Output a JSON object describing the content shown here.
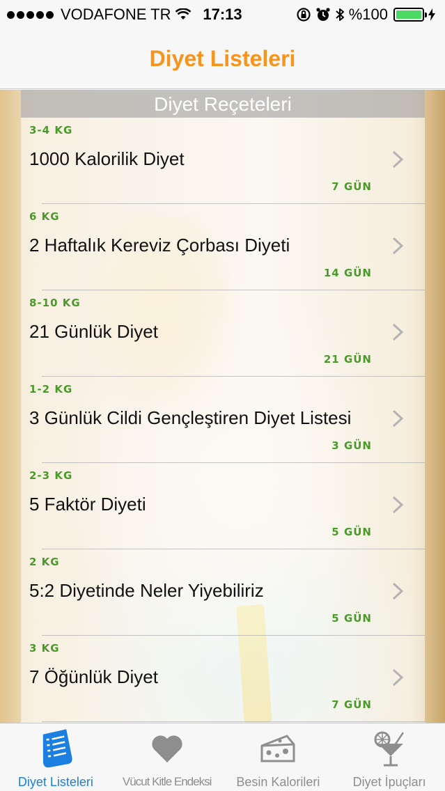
{
  "status_bar": {
    "carrier": "VODAFONE TR",
    "time": "17:13",
    "battery": "%100"
  },
  "nav": {
    "title": "Diyet Listeleri"
  },
  "section": {
    "title": "Diyet Reçeteleri"
  },
  "diets": [
    {
      "weight": "3-4 KG",
      "title": "1000 Kalorilik Diyet",
      "days": "7 GÜN"
    },
    {
      "weight": "6 KG",
      "title": "2 Haftalık Kereviz Çorbası Diyeti",
      "days": "14 GÜN"
    },
    {
      "weight": "8-10 KG",
      "title": "21 Günlük Diyet",
      "days": "21 GÜN"
    },
    {
      "weight": "1-2 KG",
      "title": "3 Günlük Cildi Gençleştiren Diyet Listesi",
      "days": "3 GÜN"
    },
    {
      "weight": "2-3 KG",
      "title": "5 Faktör Diyeti",
      "days": "5 GÜN"
    },
    {
      "weight": "2 KG",
      "title": "5:2 Diyetinde Neler Yiyebiliriz",
      "days": "5 GÜN"
    },
    {
      "weight": "3 KG",
      "title": "7 Öğünlük Diyet",
      "days": "7 GÜN"
    }
  ],
  "tabs": [
    {
      "label": "Diyet Listeleri",
      "icon": "list-document-icon"
    },
    {
      "label": "Vücut Kitle Endeksi",
      "icon": "heart-icon"
    },
    {
      "label": "Besin Kalorileri",
      "icon": "cheese-icon"
    },
    {
      "label": "Diyet İpuçları",
      "icon": "cocktail-icon"
    }
  ],
  "colors": {
    "accent": "#f7941d",
    "tab_active": "#1a7fe0",
    "green_text": "#4a9a2a",
    "battery": "#4cd964"
  }
}
